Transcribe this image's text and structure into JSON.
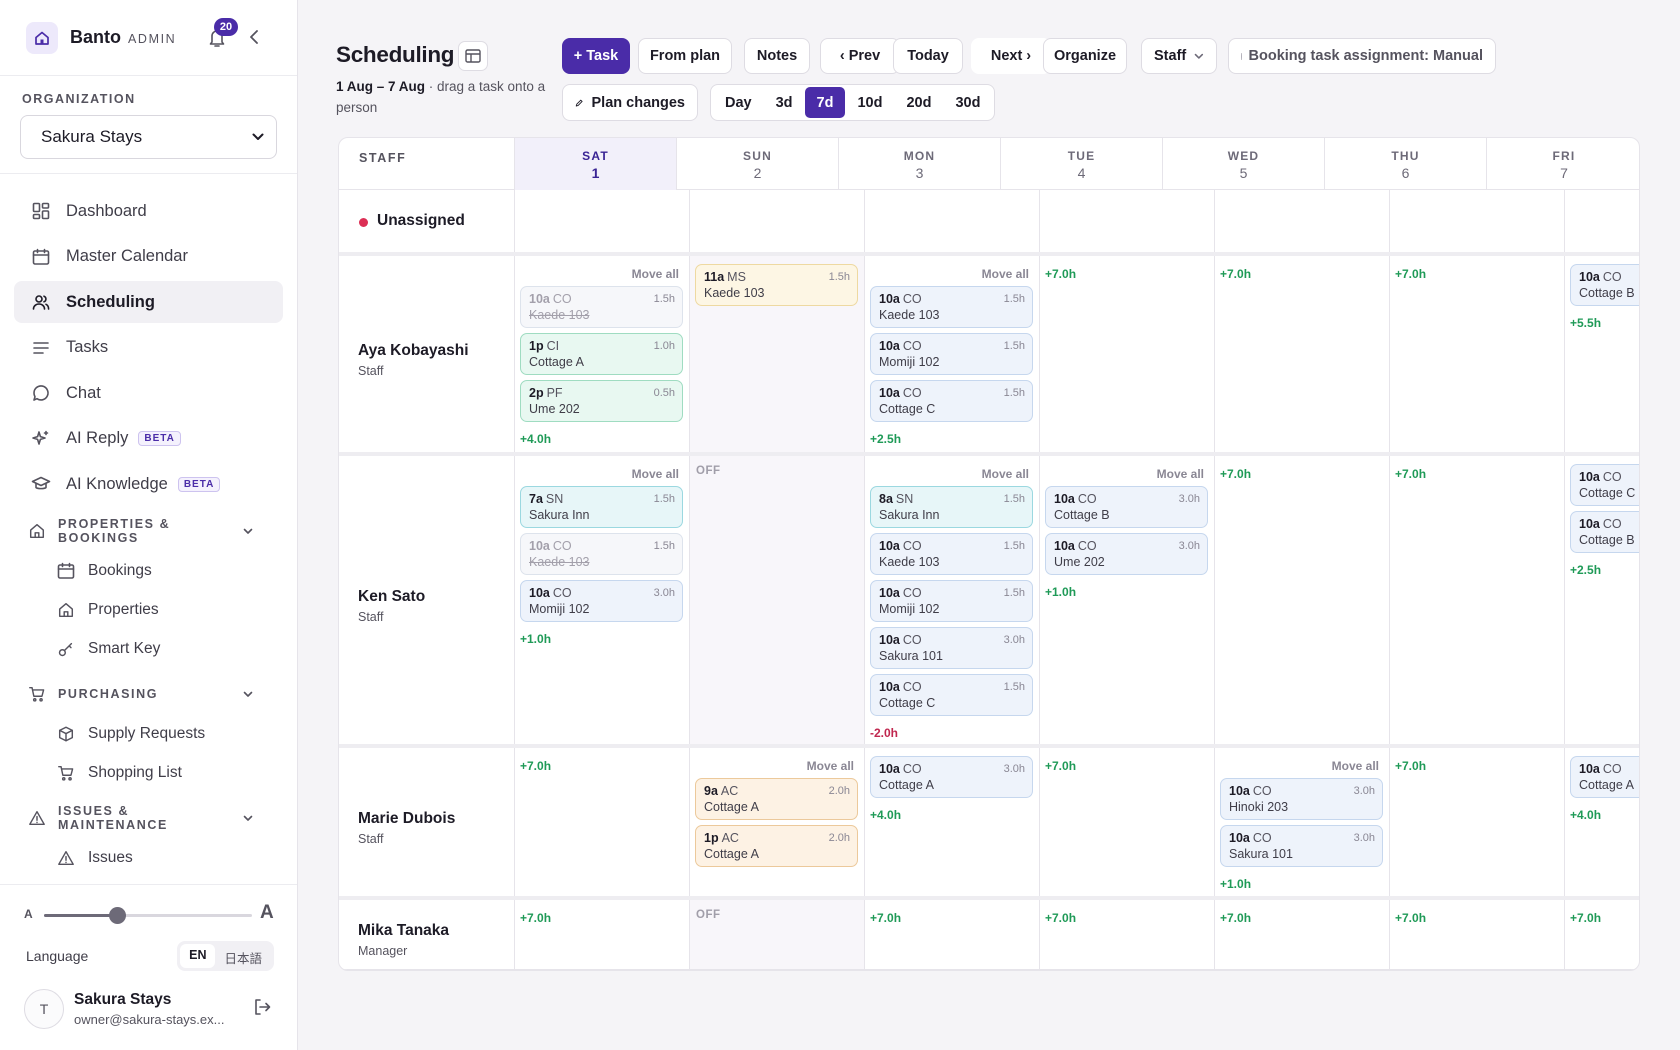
{
  "app": {
    "brand": "Banto",
    "role": "ADMIN",
    "notifications": "20"
  },
  "org": {
    "label": "ORGANIZATION",
    "selected": "Sakura Stays"
  },
  "nav": [
    {
      "label": "Dashboard",
      "icon": "dashboard-icon"
    },
    {
      "label": "Master Calendar",
      "icon": "calendar-icon"
    },
    {
      "label": "Scheduling",
      "icon": "users-icon",
      "active": true
    },
    {
      "label": "Tasks",
      "icon": "tasks-icon"
    },
    {
      "label": "Chat",
      "icon": "chat-icon"
    },
    {
      "label": "AI Reply",
      "icon": "sparkle-icon",
      "badge": "BETA"
    },
    {
      "label": "AI Knowledge",
      "icon": "graduation-cap-icon",
      "badge": "BETA"
    }
  ],
  "sections": [
    {
      "label": "PROPERTIES & BOOKINGS",
      "icon": "home-icon",
      "items": [
        {
          "label": "Bookings",
          "icon": "calendar-icon"
        },
        {
          "label": "Properties",
          "icon": "home-icon"
        },
        {
          "label": "Smart Key",
          "icon": "key-icon"
        }
      ]
    },
    {
      "label": "PURCHASING",
      "icon": "cart-icon",
      "items": [
        {
          "label": "Supply Requests",
          "icon": "box-icon"
        },
        {
          "label": "Shopping List",
          "icon": "cart-icon"
        }
      ]
    },
    {
      "label": "ISSUES & MAINTENANCE",
      "icon": "warning-icon",
      "items": [
        {
          "label": "Issues",
          "icon": "warning-icon"
        }
      ]
    }
  ],
  "bottom": {
    "font_small": "A",
    "font_large": "A",
    "font_scale": 0.35,
    "language_label": "Language",
    "lang_en": "EN",
    "lang_ja": "日本語",
    "user_initial": "T",
    "user_name": "Sakura Stays",
    "user_email": "owner@sakura-stays.ex..."
  },
  "header": {
    "title": "Scheduling",
    "range_bold": "1 Aug – 7 Aug",
    "range_hint": " · drag a task onto a person",
    "buttons": {
      "task": "+ Task",
      "from_plan": "From plan",
      "notes": "Notes",
      "prev": "‹ Prev",
      "today": "Today",
      "next": "Next ›",
      "organize": "Organize",
      "staff": "Staff",
      "assignment": "Booking task assignment: Manual",
      "plan_changes": "Plan changes"
    },
    "views": [
      "Day",
      "3d",
      "7d",
      "10d",
      "20d",
      "30d"
    ],
    "active_view": "7d"
  },
  "grid": {
    "staff_header": "STAFF",
    "move_all": "Move all",
    "off_label": "OFF",
    "unassigned": "Unassigned",
    "days": [
      {
        "dow": "SAT",
        "num": "1"
      },
      {
        "dow": "SUN",
        "num": "2"
      },
      {
        "dow": "MON",
        "num": "3"
      },
      {
        "dow": "TUE",
        "num": "4"
      },
      {
        "dow": "WED",
        "num": "5"
      },
      {
        "dow": "THU",
        "num": "6"
      },
      {
        "dow": "FRI",
        "num": "7"
      }
    ],
    "staff": [
      {
        "name": "Aya Kobayashi",
        "role": "Staff",
        "days": [
          {
            "move_all": true,
            "hours": "+4.0h",
            "tasks": [
              {
                "time": "10a",
                "type": "CO",
                "place": "Kaede 103",
                "dur": "1.5h",
                "style": "done"
              },
              {
                "time": "1p",
                "type": "CI",
                "place": "Cottage A",
                "dur": "1.0h",
                "style": "green"
              },
              {
                "time": "2p",
                "type": "PF",
                "place": "Ume 202",
                "dur": "0.5h",
                "style": "green"
              }
            ]
          },
          {
            "off_bg": true,
            "tasks": [
              {
                "time": "11a",
                "type": "MS",
                "place": "Kaede 103",
                "dur": "1.5h",
                "style": "yellow"
              }
            ]
          },
          {
            "move_all": true,
            "hours": "+2.5h",
            "tasks": [
              {
                "time": "10a",
                "type": "CO",
                "place": "Kaede 103",
                "dur": "1.5h",
                "style": "blue"
              },
              {
                "time": "10a",
                "type": "CO",
                "place": "Momiji 102",
                "dur": "1.5h",
                "style": "blue"
              },
              {
                "time": "10a",
                "type": "CO",
                "place": "Cottage C",
                "dur": "1.5h",
                "style": "blue"
              }
            ]
          },
          {
            "hours": "+7.0h",
            "tasks": []
          },
          {
            "hours": "+7.0h",
            "tasks": []
          },
          {
            "hours": "+7.0h",
            "tasks": []
          },
          {
            "hours": "+5.5h",
            "tasks": [
              {
                "time": "10a",
                "type": "CO",
                "place": "Cottage B",
                "dur": "",
                "style": "blue"
              }
            ]
          }
        ]
      },
      {
        "name": "Ken Sato",
        "role": "Staff",
        "days": [
          {
            "move_all": true,
            "hours": "+1.0h",
            "tasks": [
              {
                "time": "7a",
                "type": "SN",
                "place": "Sakura Inn",
                "dur": "1.5h",
                "style": "teal"
              },
              {
                "time": "10a",
                "type": "CO",
                "place": "Kaede 103",
                "dur": "1.5h",
                "style": "done"
              },
              {
                "time": "10a",
                "type": "CO",
                "place": "Momiji 102",
                "dur": "3.0h",
                "style": "blue"
              }
            ]
          },
          {
            "off": true,
            "tasks": []
          },
          {
            "move_all": true,
            "hours": "-2.0h",
            "tasks": [
              {
                "time": "8a",
                "type": "SN",
                "place": "Sakura Inn",
                "dur": "1.5h",
                "style": "teal"
              },
              {
                "time": "10a",
                "type": "CO",
                "place": "Kaede 103",
                "dur": "1.5h",
                "style": "blue"
              },
              {
                "time": "10a",
                "type": "CO",
                "place": "Momiji 102",
                "dur": "1.5h",
                "style": "blue"
              },
              {
                "time": "10a",
                "type": "CO",
                "place": "Sakura 101",
                "dur": "3.0h",
                "style": "blue"
              },
              {
                "time": "10a",
                "type": "CO",
                "place": "Cottage C",
                "dur": "1.5h",
                "style": "blue"
              }
            ]
          },
          {
            "move_all": true,
            "hours": "+1.0h",
            "tasks": [
              {
                "time": "10a",
                "type": "CO",
                "place": "Cottage B",
                "dur": "3.0h",
                "style": "blue"
              },
              {
                "time": "10a",
                "type": "CO",
                "place": "Ume 202",
                "dur": "3.0h",
                "style": "blue"
              }
            ]
          },
          {
            "hours": "+7.0h",
            "tasks": []
          },
          {
            "hours": "+7.0h",
            "tasks": []
          },
          {
            "hours": "+2.5h",
            "tasks": [
              {
                "time": "10a",
                "type": "CO",
                "place": "Cottage C",
                "dur": "",
                "style": "blue"
              },
              {
                "time": "10a",
                "type": "CO",
                "place": "Cottage B",
                "dur": "",
                "style": "blue"
              }
            ]
          }
        ]
      },
      {
        "name": "Marie Dubois",
        "role": "Staff",
        "days": [
          {
            "hours": "+7.0h",
            "tasks": []
          },
          {
            "move_all": true,
            "tasks": [
              {
                "time": "9a",
                "type": "AC",
                "place": "Cottage A",
                "dur": "2.0h",
                "style": "orange"
              },
              {
                "time": "1p",
                "type": "AC",
                "place": "Cottage A",
                "dur": "2.0h",
                "style": "orange"
              }
            ]
          },
          {
            "hours": "+4.0h",
            "tasks": [
              {
                "time": "10a",
                "type": "CO",
                "place": "Cottage A",
                "dur": "3.0h",
                "style": "blue"
              }
            ]
          },
          {
            "hours": "+7.0h",
            "tasks": []
          },
          {
            "move_all": true,
            "hours": "+1.0h",
            "tasks": [
              {
                "time": "10a",
                "type": "CO",
                "place": "Hinoki 203",
                "dur": "3.0h",
                "style": "blue"
              },
              {
                "time": "10a",
                "type": "CO",
                "place": "Sakura 101",
                "dur": "3.0h",
                "style": "blue"
              }
            ]
          },
          {
            "hours": "+7.0h",
            "tasks": []
          },
          {
            "hours": "+4.0h",
            "tasks": [
              {
                "time": "10a",
                "type": "CO",
                "place": "Cottage A",
                "dur": "",
                "style": "blue"
              }
            ]
          }
        ]
      },
      {
        "name": "Mika Tanaka",
        "role": "Manager",
        "days": [
          {
            "hours": "+7.0h",
            "tasks": []
          },
          {
            "off": true,
            "tasks": []
          },
          {
            "hours": "+7.0h",
            "tasks": []
          },
          {
            "hours": "+7.0h",
            "tasks": []
          },
          {
            "hours": "+7.0h",
            "tasks": []
          },
          {
            "hours": "+7.0h",
            "tasks": []
          },
          {
            "hours": "+7.0h",
            "tasks": []
          }
        ]
      }
    ]
  }
}
